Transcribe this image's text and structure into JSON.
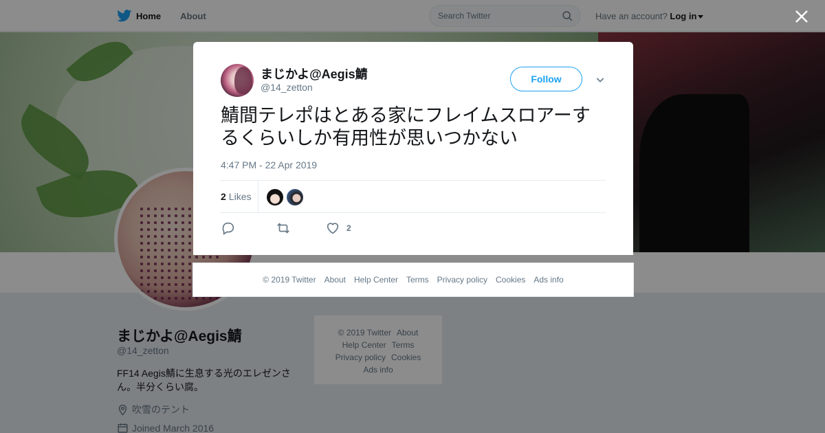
{
  "nav": {
    "home": "Home",
    "about": "About",
    "search_placeholder": "Search Twitter",
    "account_prompt": "Have an account?",
    "login": "Log in"
  },
  "profile": {
    "name": "まじかよ@Aegis鯖",
    "handle": "@14_zetton",
    "bio": "FF14 Aegis鯖に生息する光のエレゼンさん。半分くらい腐。",
    "location": "吹雪のテント",
    "joined": "Joined March 2016"
  },
  "side_footer": {
    "copyright": "© 2019 Twitter",
    "about": "About",
    "help": "Help Center",
    "terms": "Terms",
    "privacy": "Privacy policy",
    "cookies": "Cookies",
    "ads": "Ads info"
  },
  "tweet": {
    "author_name": "まじかよ@Aegis鯖",
    "author_handle": "@14_zetton",
    "follow_label": "Follow",
    "text": "鯖間テレポはとある家にフレイムスロアーするくらいしか有用性が思いつかない",
    "timestamp": "4:47 PM - 22 Apr 2019",
    "likes_count": "2",
    "likes_label": "Likes",
    "like_action_count": "2"
  },
  "modal_footer": {
    "copyright": "© 2019 Twitter",
    "about": "About",
    "help": "Help Center",
    "terms": "Terms",
    "privacy": "Privacy policy",
    "cookies": "Cookies",
    "ads": "Ads info"
  },
  "colors": {
    "accent": "#1da1f2",
    "secondary_text": "#657786",
    "overlay": "rgba(0,0,0,0.45)"
  },
  "icons": [
    "twitter-bird-icon",
    "search-icon",
    "close-icon",
    "chevron-down-icon",
    "reply-icon",
    "retweet-icon",
    "heart-icon",
    "location-icon",
    "calendar-icon"
  ]
}
